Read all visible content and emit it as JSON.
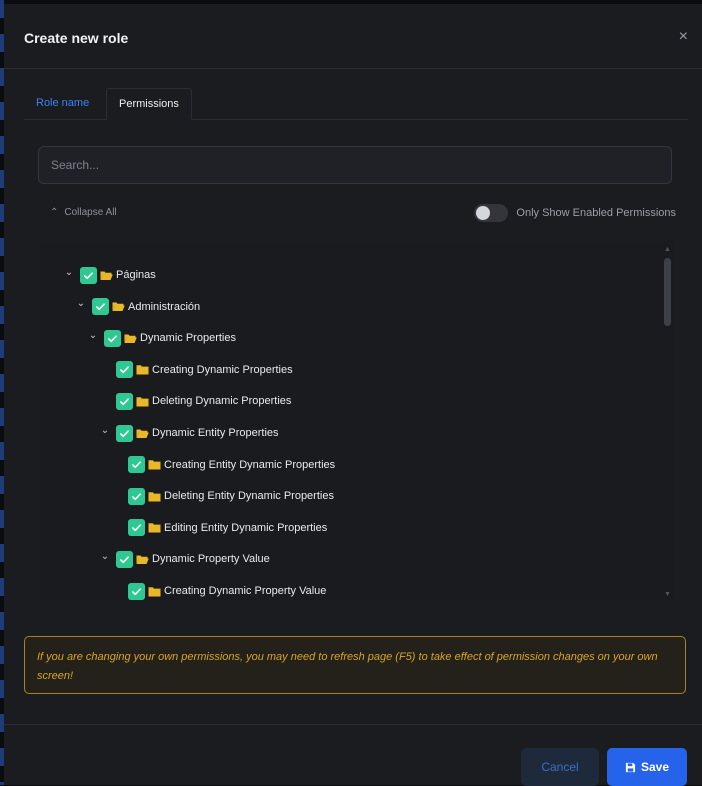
{
  "modal": {
    "title": "Create new role",
    "close_glyph": "×"
  },
  "tabs": [
    {
      "label": "Role name",
      "active": false
    },
    {
      "label": "Permissions",
      "active": true
    }
  ],
  "search": {
    "placeholder": "Search...",
    "value": ""
  },
  "tree_controls": {
    "collapse_all_label": "Collapse All",
    "only_enabled_label": "Only Show Enabled Permissions",
    "only_enabled_on": false
  },
  "tree": [
    {
      "label": "Páginas",
      "level": 0,
      "expanded": true,
      "checked": true,
      "has_children": true
    },
    {
      "label": "Administración",
      "level": 1,
      "expanded": true,
      "checked": true,
      "has_children": true
    },
    {
      "label": "Dynamic Properties",
      "level": 2,
      "expanded": true,
      "checked": true,
      "has_children": true
    },
    {
      "label": "Creating Dynamic Properties",
      "level": 3,
      "checked": true,
      "has_children": false
    },
    {
      "label": "Deleting Dynamic Properties",
      "level": 3,
      "checked": true,
      "has_children": false
    },
    {
      "label": "Dynamic Entity Properties",
      "level": 3,
      "expanded": true,
      "checked": true,
      "has_children": true
    },
    {
      "label": "Creating Entity Dynamic Properties",
      "level": 4,
      "checked": true,
      "has_children": false
    },
    {
      "label": "Deleting Entity Dynamic Properties",
      "level": 4,
      "checked": true,
      "has_children": false
    },
    {
      "label": "Editing Entity Dynamic Properties",
      "level": 4,
      "checked": true,
      "has_children": false
    },
    {
      "label": "Dynamic Property Value",
      "level": 3,
      "expanded": true,
      "checked": true,
      "has_children": true
    },
    {
      "label": "Creating Dynamic Property Value",
      "level": 4,
      "checked": true,
      "has_children": false
    }
  ],
  "notice": {
    "text": "If you are changing your own permissions, you may need to refresh page (F5) to take effect of permission changes on your own screen!"
  },
  "footer": {
    "cancel_label": "Cancel",
    "save_label": "Save"
  },
  "colors": {
    "accent": "#2563eb",
    "check": "#2fc892",
    "folder": "#e9b829",
    "warning": "#d6a52a"
  }
}
